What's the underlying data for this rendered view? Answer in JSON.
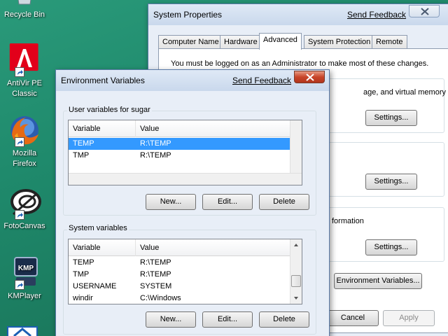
{
  "desktop": {
    "icons": [
      {
        "label": "Recycle Bin",
        "icon": "recycle-bin-icon"
      },
      {
        "label": "AntiVir PE Classic",
        "line1": "AntiVir PE",
        "line2": "Classic",
        "icon": "antivir-icon",
        "color": "#e2001a"
      },
      {
        "label": "Mozilla Firefox",
        "line1": "Mozilla",
        "line2": "Firefox",
        "icon": "firefox-icon"
      },
      {
        "label": "FotoCanvas",
        "icon": "fotocanvas-icon"
      },
      {
        "label": "KMPlayer",
        "icon": "kmplayer-icon",
        "badge": "KMP"
      }
    ]
  },
  "system_properties": {
    "title": "System Properties",
    "feedback_label": "Send Feedback",
    "tabs": [
      {
        "label": "Computer Name",
        "active": false
      },
      {
        "label": "Hardware",
        "active": false
      },
      {
        "label": "Advanced",
        "active": true
      },
      {
        "label": "System Protection",
        "active": false
      },
      {
        "label": "Remote",
        "active": false
      }
    ],
    "admin_note": "You must be logged on as an Administrator to make most of these changes.",
    "performance_fragment": "age, and virtual memory",
    "startup_fragment": "formation",
    "settings_label": "Settings...",
    "env_button_label": "Environment Variables...",
    "cancel_label": "Cancel",
    "apply_label": "Apply"
  },
  "env_vars": {
    "title": "Environment Variables",
    "feedback_label": "Send Feedback",
    "user_group_label": "User variables for sugar",
    "system_group_label": "System variables",
    "columns": {
      "variable": "Variable",
      "value": "Value"
    },
    "user_rows": [
      {
        "variable": "TEMP",
        "value": "R:\\TEMP",
        "selected": true
      },
      {
        "variable": "TMP",
        "value": "R:\\TEMP",
        "selected": false
      }
    ],
    "system_rows": [
      {
        "variable": "TEMP",
        "value": "R:\\TEMP"
      },
      {
        "variable": "TMP",
        "value": "R:\\TEMP"
      },
      {
        "variable": "USERNAME",
        "value": "SYSTEM"
      },
      {
        "variable": "windir",
        "value": "C:\\Windows"
      }
    ],
    "new_label": "New...",
    "edit_label": "Edit...",
    "delete_label": "Delete"
  },
  "colors": {
    "selection": "#3399ff",
    "desktop": "#1f8a6c",
    "close_button": "#c8452a"
  }
}
